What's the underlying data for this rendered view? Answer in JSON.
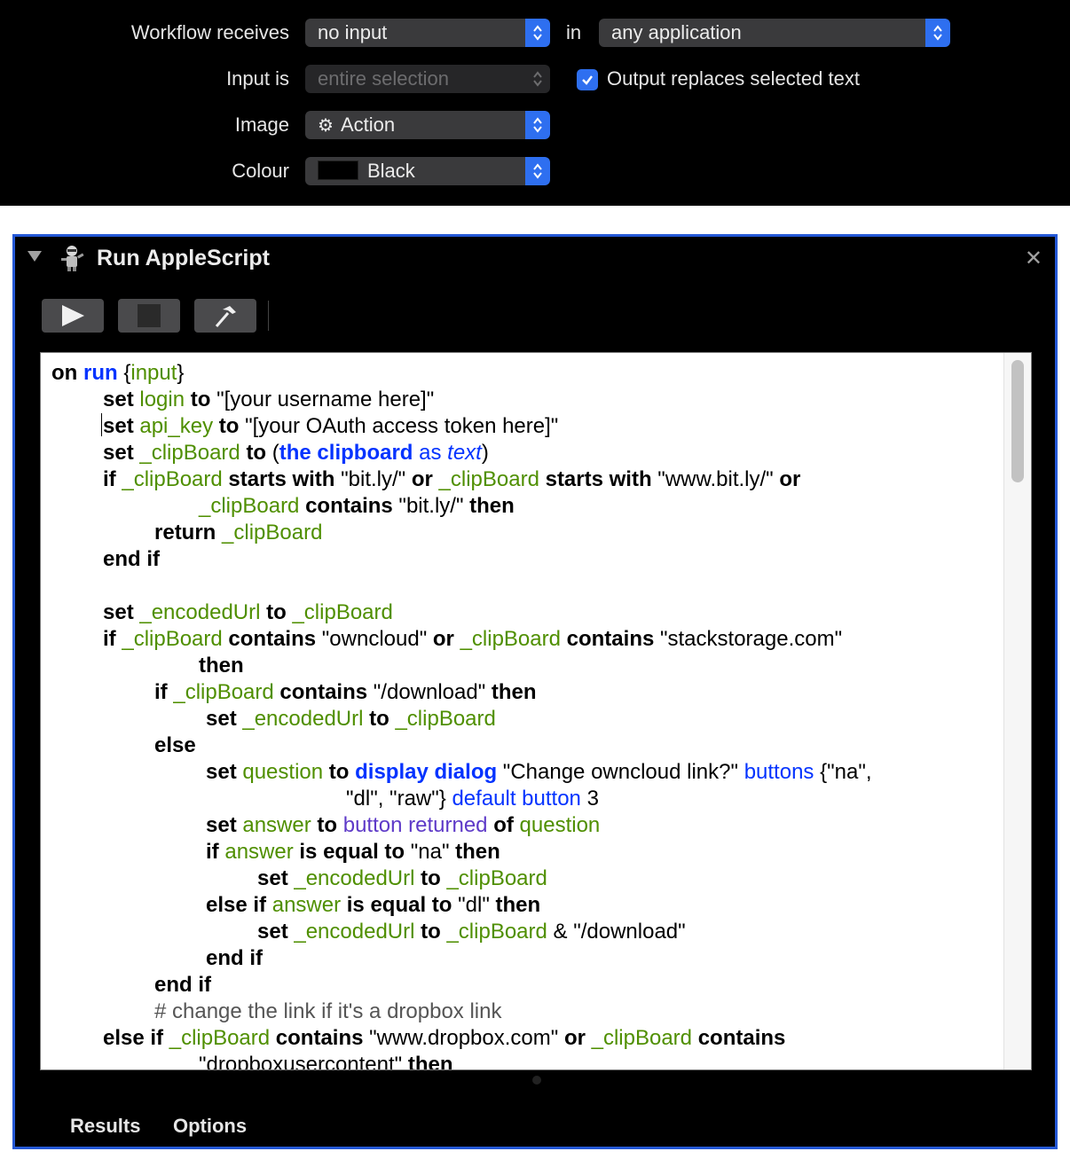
{
  "workflow": {
    "receives_label": "Workflow receives",
    "receives_value": "no input",
    "in_label": "in",
    "application_value": "any application",
    "input_is_label": "Input is",
    "input_is_value": "entire selection",
    "output_replaces_label": "Output replaces selected text",
    "output_replaces_checked": true,
    "image_label": "Image",
    "image_value": "Action",
    "colour_label": "Colour",
    "colour_value": "Black",
    "colour_swatch": "#000000"
  },
  "action": {
    "title": "Run AppleScript",
    "toolbar": {
      "run_icon": "play-icon",
      "stop_icon": "stop-icon",
      "compile_icon": "hammer-icon"
    },
    "code_lines": [
      "on run {input}",
      "set login to \"[your username here]\"",
      "set api_key to \"[your OAuth access token here]\"",
      "set _clipBoard to (the clipboard as text)",
      "if _clipBoard starts with \"bit.ly/\" or _clipBoard starts with \"www.bit.ly/\" or",
      "_clipBoard contains \"bit.ly/\" then",
      "return _clipBoard",
      "end if",
      "",
      "set _encodedUrl to _clipBoard",
      "if _clipBoard contains \"owncloud\" or _clipBoard contains \"stackstorage.com\"",
      "then",
      "if _clipBoard contains \"/download\" then",
      "set _encodedUrl to _clipBoard",
      "else",
      "set question to display dialog \"Change owncloud link?\" buttons {\"na\",",
      "\"dl\", \"raw\"} default button 3",
      "set answer to button returned of question",
      "if answer is equal to \"na\" then",
      "set _encodedUrl to _clipBoard",
      "else if answer is equal to \"dl\" then",
      "set _encodedUrl to _clipBoard & \"/download\"",
      "end if",
      "end if",
      "# change the link if it's a dropbox link",
      "else if _clipBoard contains \"www.dropbox.com\" or _clipBoard contains",
      "\"dropboxusercontent\" then"
    ],
    "tabs": {
      "results": "Results",
      "options": "Options"
    }
  },
  "colors": {
    "accent": "#2e6ff0",
    "panel_border": "#2458d6",
    "variable": "#4f8f00",
    "command": "#0433ff",
    "property": "#5e3ac8"
  }
}
